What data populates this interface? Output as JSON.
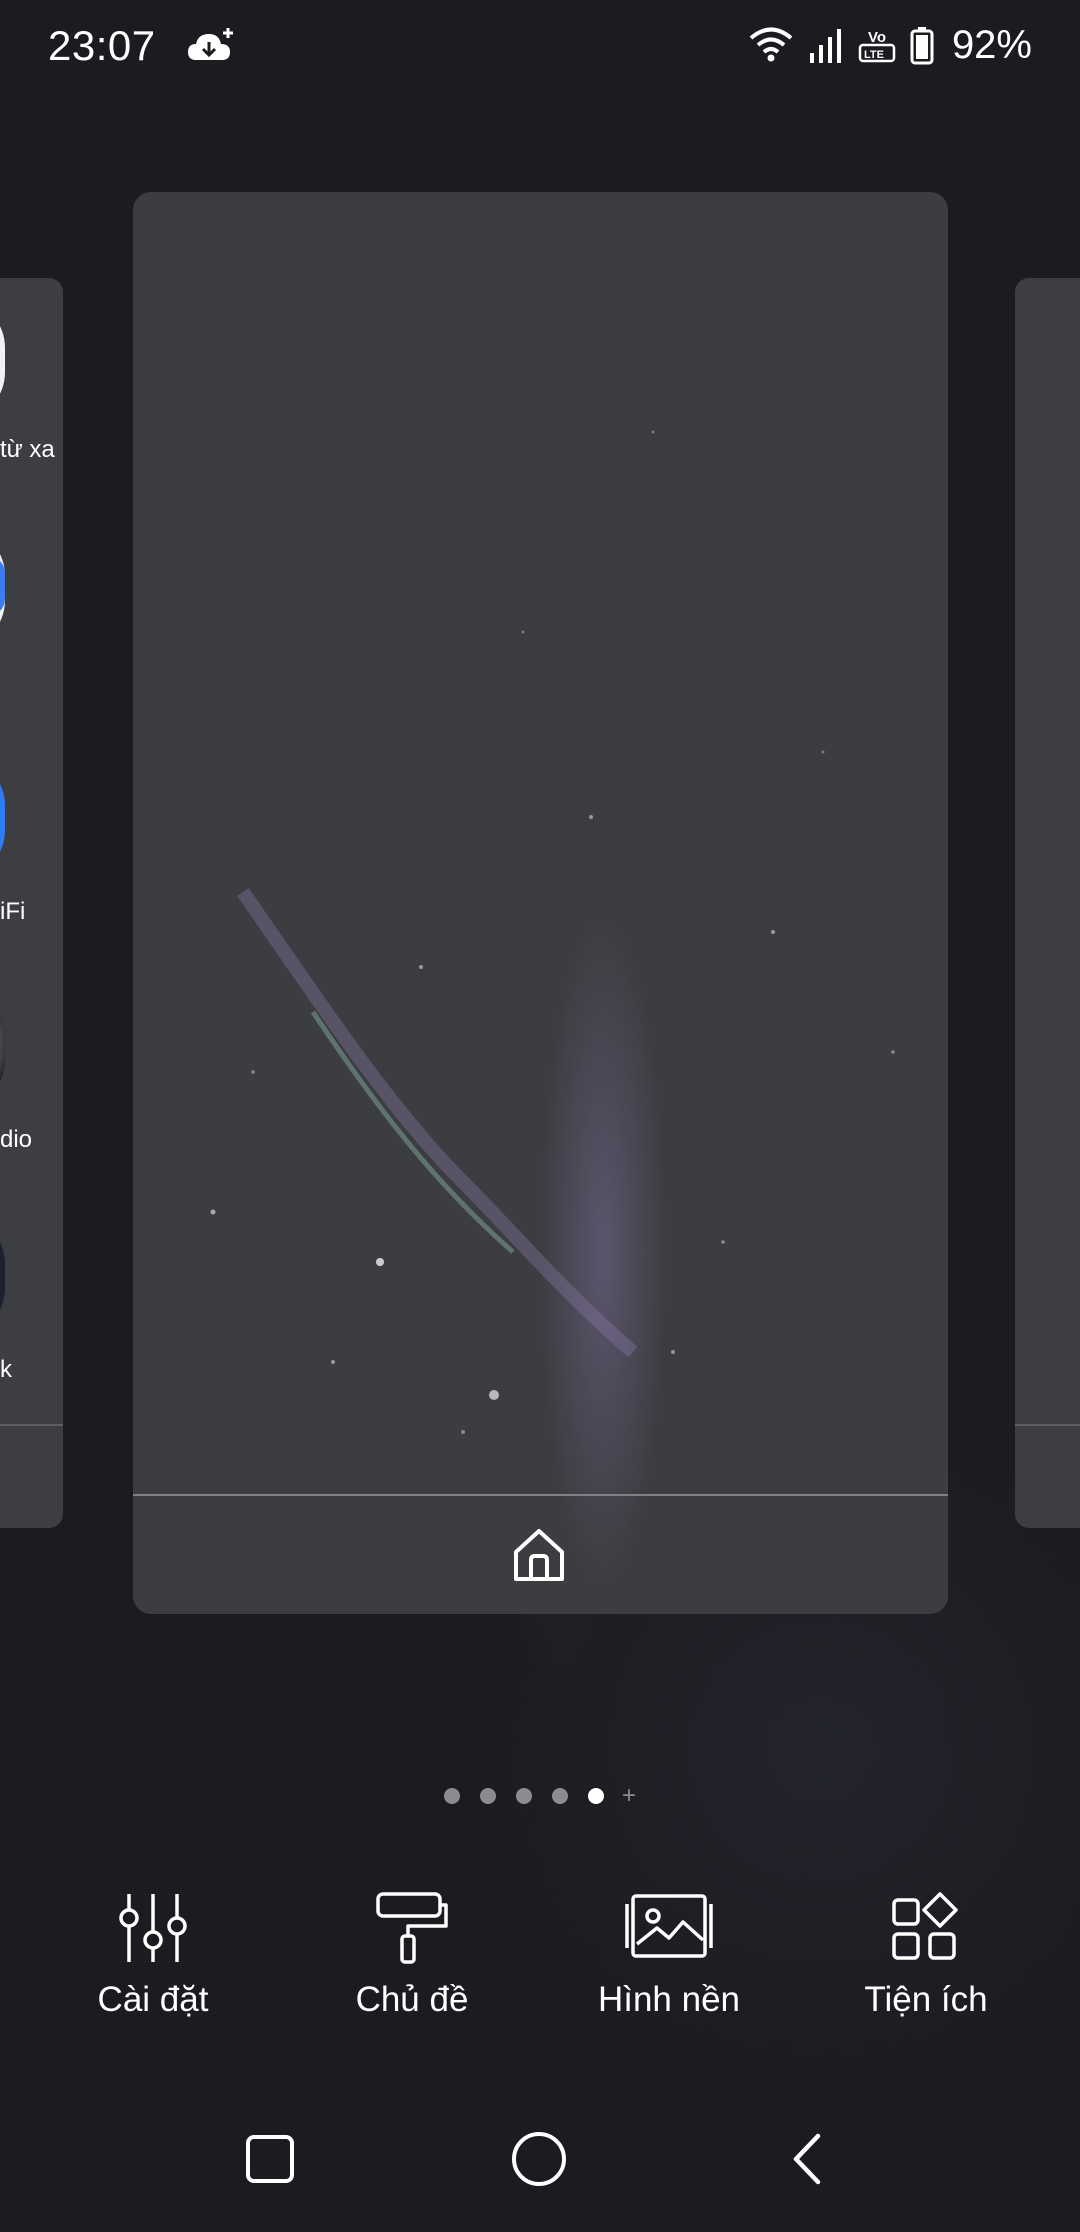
{
  "status_bar": {
    "time": "23:07",
    "battery": "92%",
    "icons": [
      "cloud-download-icon",
      "wifi-icon",
      "signal-icon",
      "volte-icon",
      "battery-icon"
    ],
    "volte_top": "Vo",
    "volte_bottom": "LTE"
  },
  "left_page_peek": {
    "labels": [
      "từ xa",
      "iFi",
      "dio",
      "k"
    ]
  },
  "page_indicator": {
    "pages": 5,
    "active": 5,
    "add_symbol": "+"
  },
  "actions": [
    {
      "label": "Cài đặt",
      "icon": "sliders-icon"
    },
    {
      "label": "Chủ đề",
      "icon": "paint-roller-icon"
    },
    {
      "label": "Hình nền",
      "icon": "wallpaper-icon"
    },
    {
      "label": "Tiện ích",
      "icon": "widgets-icon"
    }
  ],
  "nav_bar": {
    "icons": [
      "recents-icon",
      "home-icon",
      "back-icon"
    ]
  },
  "colors": {
    "background": "#1b1c20",
    "card": "#3c3d41",
    "dot_active": "#ffffff",
    "dot_inactive": "#8b8c90"
  }
}
